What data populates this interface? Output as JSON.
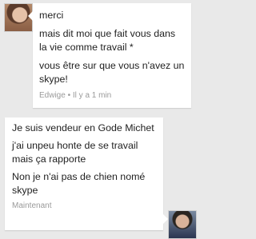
{
  "chat": {
    "incoming": {
      "messages": [
        "merci",
        "mais dit moi que fait vous dans la vie comme travail *",
        "vous être sur que vous n'avez un skype!"
      ],
      "sender": "Edwige",
      "separator": "•",
      "time": "Il y a 1 min"
    },
    "outgoing": {
      "messages": [
        "Je suis vendeur en Gode Michet",
        "j'ai unpeu honte de se travail mais ça rapporte",
        "Non je n'ai pas de chien nomé skype"
      ],
      "time": "Maintenant"
    }
  }
}
